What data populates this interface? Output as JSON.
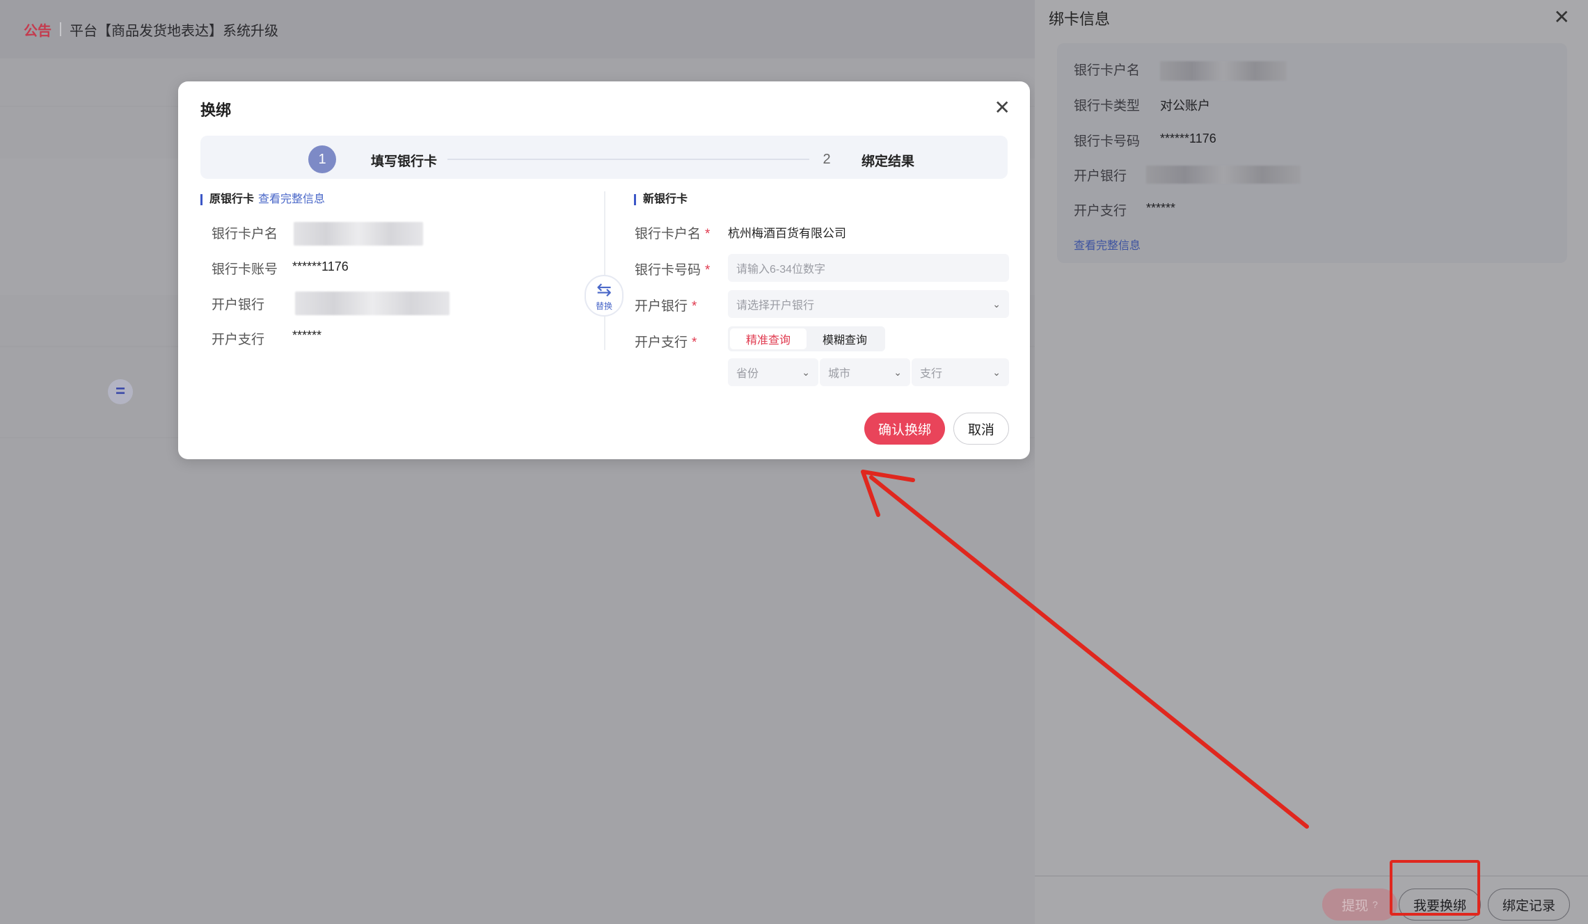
{
  "notice": {
    "tag": "公告",
    "text": "平台【商品发货地表达】系统升级"
  },
  "modal": {
    "title": "换绑",
    "close_icon": "close-icon",
    "steps": [
      {
        "num": "1",
        "label": "填写银行卡"
      },
      {
        "num": "2",
        "label": "绑定结果"
      }
    ],
    "old_card": {
      "title": "原银行卡",
      "link": "查看完整信息",
      "labels": {
        "name": "银行卡户名",
        "number": "银行卡账号",
        "bank": "开户银行",
        "branch": "开户支行"
      },
      "values": {
        "number": "******1176",
        "branch": "******"
      }
    },
    "swap": {
      "icon": "swap-icon",
      "label": "替换"
    },
    "new_card": {
      "title": "新银行卡",
      "labels": {
        "name": "银行卡户名",
        "number": "银行卡号码",
        "bank": "开户银行",
        "branch": "开户支行"
      },
      "required_mark": "*",
      "name_value": "杭州梅酒百货有限公司",
      "number_placeholder": "请输入6-34位数字",
      "bank_placeholder": "请选择开户银行",
      "query_modes": [
        "精准查询",
        "模糊查询"
      ],
      "selects": [
        "省份",
        "城市",
        "支行"
      ]
    },
    "buttons": {
      "confirm": "确认换绑",
      "cancel": "取消"
    }
  },
  "drawer": {
    "title": "绑卡信息",
    "labels": {
      "name": "银行卡户名",
      "type": "银行卡类型",
      "number": "银行卡号码",
      "bank": "开户银行",
      "branch": "开户支行"
    },
    "values": {
      "type": "对公账户",
      "number": "******1176",
      "branch": "******"
    },
    "link": "查看完整信息",
    "buttons": {
      "withdraw": "提现",
      "rebind": "我要换绑",
      "record": "绑定记录"
    }
  },
  "annotation": {
    "color": "#e0271e"
  }
}
